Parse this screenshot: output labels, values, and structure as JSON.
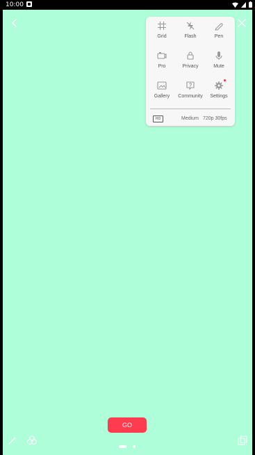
{
  "status_bar": {
    "time": "10:00"
  },
  "menu": {
    "items": [
      {
        "label": "Grid",
        "icon": "grid-icon"
      },
      {
        "label": "Flash",
        "icon": "flash-off-icon"
      },
      {
        "label": "Pen",
        "icon": "pen-icon"
      },
      {
        "label": "Pro",
        "icon": "pro-camera-icon"
      },
      {
        "label": "Privacy",
        "icon": "lock-icon"
      },
      {
        "label": "Mute",
        "icon": "mic-icon"
      },
      {
        "label": "Gallery",
        "icon": "gallery-icon"
      },
      {
        "label": "Community",
        "icon": "community-icon"
      },
      {
        "label": "Settings",
        "icon": "settings-icon"
      }
    ],
    "hd_badge": "HD",
    "resolution_label": "Medium",
    "resolution_value": "720p 30fps"
  },
  "go_button": {
    "label": "GO"
  },
  "colors": {
    "preview_bg": "#aefed9",
    "accent": "#ff3b4f",
    "notification_dot": "#ff2a2a"
  }
}
